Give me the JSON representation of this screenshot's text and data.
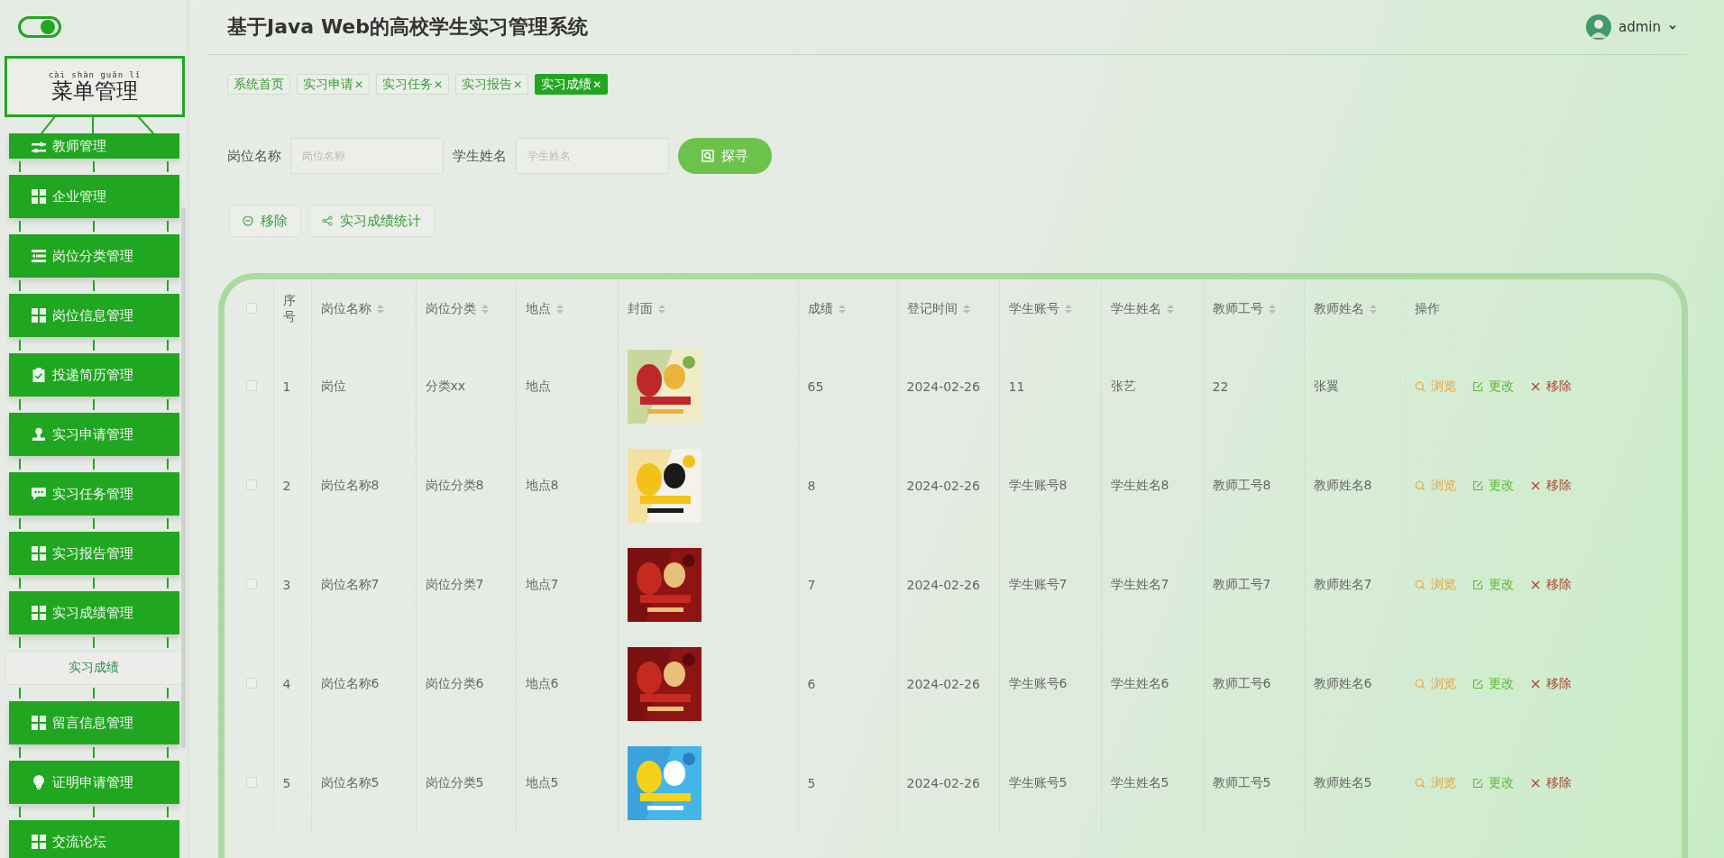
{
  "sidebar": {
    "toggle": {
      "on": true
    },
    "menu_header": {
      "pinyin": "cài shàn guǎn lǐ",
      "title": "菜单管理"
    },
    "items": [
      {
        "label": "教师管理"
      },
      {
        "label": "企业管理"
      },
      {
        "label": "岗位分类管理"
      },
      {
        "label": "岗位信息管理"
      },
      {
        "label": "投递简历管理"
      },
      {
        "label": "实习申请管理"
      },
      {
        "label": "实习任务管理"
      },
      {
        "label": "实习报告管理"
      },
      {
        "label": "实习成绩管理",
        "children": [
          {
            "label": "实习成绩",
            "selected": true
          }
        ]
      },
      {
        "label": "留言信息管理"
      },
      {
        "label": "证明申请管理"
      },
      {
        "label": "交流论坛"
      }
    ]
  },
  "header": {
    "title": "基于Java Web的高校学生实习管理系统",
    "user": "admin"
  },
  "tabs": [
    {
      "label": "系统首页",
      "closable": false,
      "selected": false
    },
    {
      "label": "实习申请",
      "closable": true,
      "selected": false
    },
    {
      "label": "实习任务",
      "closable": true,
      "selected": false
    },
    {
      "label": "实习报告",
      "closable": true,
      "selected": false
    },
    {
      "label": "实习成绩",
      "closable": true,
      "selected": true
    }
  ],
  "close_glyph": "✕",
  "search": {
    "fields": [
      {
        "label": "岗位名称",
        "placeholder": "岗位名称"
      },
      {
        "label": "学生姓名",
        "placeholder": "学生姓名"
      }
    ],
    "button": "探寻"
  },
  "actions": [
    {
      "kind": "remove",
      "label": "移除"
    },
    {
      "kind": "stats",
      "label": "实习成绩统计"
    }
  ],
  "table": {
    "header_checked": false,
    "columns": [
      {
        "label": "序号",
        "sortable": false
      },
      {
        "label": "岗位名称",
        "sortable": true
      },
      {
        "label": "岗位分类",
        "sortable": true
      },
      {
        "label": "地点",
        "sortable": true
      },
      {
        "label": "封面",
        "sortable": true
      },
      {
        "label": "成绩",
        "sortable": true
      },
      {
        "label": "登记时间",
        "sortable": true
      },
      {
        "label": "学生账号",
        "sortable": true
      },
      {
        "label": "学生姓名",
        "sortable": true
      },
      {
        "label": "教师工号",
        "sortable": true
      },
      {
        "label": "教师姓名",
        "sortable": true
      },
      {
        "label": "操作",
        "sortable": false
      }
    ],
    "rows": [
      {
        "checked": false,
        "cells": [
          "1",
          "岗位",
          "分类xx",
          "地点"
        ],
        "cover": {
          "kind": "picture"
        },
        "rest": [
          "65",
          "2024-02-26",
          "11",
          "张艺",
          "22",
          "张翼"
        ],
        "actions": [
          {
            "kind": "view",
            "label": "浏览"
          },
          {
            "kind": "edit",
            "label": "更改"
          },
          {
            "kind": "delete",
            "label": "移除"
          }
        ]
      },
      {
        "checked": false,
        "cells": [
          "2",
          "岗位名称8",
          "岗位分类8",
          "地点8"
        ],
        "cover": {
          "kind": "picture"
        },
        "rest": [
          "8",
          "2024-02-26",
          "学生账号8",
          "学生姓名8",
          "教师工号8",
          "教师姓名8"
        ],
        "actions": [
          {
            "kind": "view",
            "label": "浏览"
          },
          {
            "kind": "edit",
            "label": "更改"
          },
          {
            "kind": "delete",
            "label": "移除"
          }
        ]
      },
      {
        "checked": false,
        "cells": [
          "3",
          "岗位名称7",
          "岗位分类7",
          "地点7"
        ],
        "cover": {
          "kind": "picture"
        },
        "rest": [
          "7",
          "2024-02-26",
          "学生账号7",
          "学生姓名7",
          "教师工号7",
          "教师姓名7"
        ],
        "actions": [
          {
            "kind": "view",
            "label": "浏览"
          },
          {
            "kind": "edit",
            "label": "更改"
          },
          {
            "kind": "delete",
            "label": "移除"
          }
        ]
      },
      {
        "checked": false,
        "cells": [
          "4",
          "岗位名称6",
          "岗位分类6",
          "地点6"
        ],
        "cover": {
          "kind": "picture"
        },
        "rest": [
          "6",
          "2024-02-26",
          "学生账号6",
          "学生姓名6",
          "教师工号6",
          "教师姓名6"
        ],
        "actions": [
          {
            "kind": "view",
            "label": "浏览"
          },
          {
            "kind": "edit",
            "label": "更改"
          },
          {
            "kind": "delete",
            "label": "移除"
          }
        ]
      },
      {
        "checked": false,
        "cells": [
          "5",
          "岗位名称5",
          "岗位分类5",
          "地点5"
        ],
        "cover": {
          "kind": "picture"
        },
        "rest": [
          "5",
          "2024-02-26",
          "学生账号5",
          "学生姓名5",
          "教师工号5",
          "教师姓名5"
        ],
        "actions": [
          {
            "kind": "view",
            "label": "浏览"
          },
          {
            "kind": "edit",
            "label": "更改"
          },
          {
            "kind": "delete",
            "label": "移除"
          }
        ]
      }
    ]
  }
}
